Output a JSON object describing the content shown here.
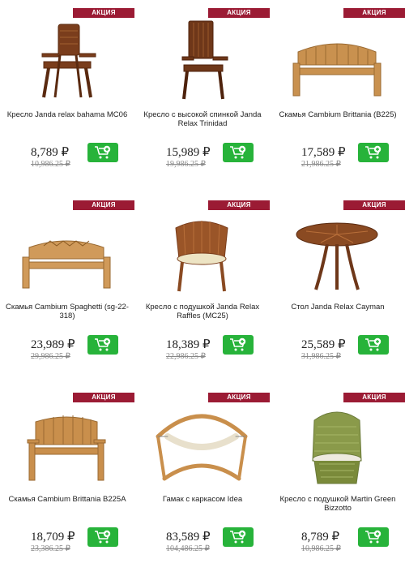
{
  "currency": "₽",
  "products": [
    {
      "badge": "АКЦИЯ",
      "name": "Кресло Janda relax bahama MC06",
      "price": "8,789 ₽",
      "old_price": "10,986.25 ₽",
      "image": "folding-armchair-wood"
    },
    {
      "badge": "АКЦИЯ",
      "name": "Кресло с высокой спинкой Janda Relax Trinidad",
      "price": "15,989 ₽",
      "old_price": "19,986.25 ₽",
      "image": "highback-armchair-wood"
    },
    {
      "badge": "АКЦИЯ",
      "name": "Скамья Cambium Brittania (B225)",
      "price": "17,589 ₽",
      "old_price": "21,986.25 ₽",
      "image": "bench-teak"
    },
    {
      "badge": "АКЦИЯ",
      "name": "Скамья Cambium Spaghetti (sg-22-318)",
      "price": "23,989 ₽",
      "old_price": "29,986.25 ₽",
      "image": "bench-lattice"
    },
    {
      "badge": "АКЦИЯ",
      "name": "Кресло с подушкой Janda Relax Raffles (MC25)",
      "price": "18,389 ₽",
      "old_price": "22,986.25 ₽",
      "image": "tub-chair-cushion"
    },
    {
      "badge": "АКЦИЯ",
      "name": "Стол Janda Relax Cayman",
      "price": "25,589 ₽",
      "old_price": "31,986.25 ₽",
      "image": "round-table"
    },
    {
      "badge": "АКЦИЯ",
      "name": "Скамья Cambium Brittania B225A",
      "price": "18,709 ₽",
      "old_price": "23,386.25 ₽",
      "image": "bench-teak-small"
    },
    {
      "badge": "АКЦИЯ",
      "name": "Гамак с каркасом Idea",
      "price": "83,589 ₽",
      "old_price": "104,486.25 ₽",
      "image": "hammock-frame"
    },
    {
      "badge": "АКЦИЯ",
      "name": "Кресло с подушкой Martin Green Bizzotto",
      "price": "8,789 ₽",
      "old_price": "10,986.25 ₽",
      "image": "wicker-chair-green"
    }
  ],
  "colors": {
    "badge": "#9b1b34",
    "cart_button": "#27b33a",
    "wood": "#8a4a22",
    "teak": "#c9914f"
  },
  "icons": {
    "cart": "cart-plus-icon"
  }
}
